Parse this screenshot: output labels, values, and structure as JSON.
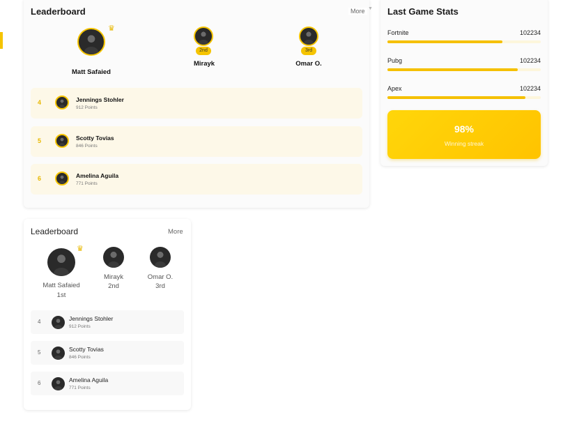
{
  "leaderboard_primary": {
    "title": "Leaderboard",
    "more_label": "More",
    "podium": [
      {
        "name": "Matt Safaied",
        "badge": "",
        "icon": "crown-icon"
      },
      {
        "name": "Mirayk",
        "badge": "2nd"
      },
      {
        "name": "Omar O.",
        "badge": "3rd"
      }
    ],
    "rows": [
      {
        "rank": "4",
        "name": "Jennings Stohler",
        "points": "912 Points"
      },
      {
        "rank": "5",
        "name": "Scotty Tovias",
        "points": "846 Points"
      },
      {
        "rank": "6",
        "name": "Amelina Aguila",
        "points": "771 Points"
      }
    ]
  },
  "last_game_stats": {
    "title": "Last Game Stats",
    "games": [
      {
        "name": "Fortnite",
        "value": "102234",
        "progress": 0.75
      },
      {
        "name": "Pubg",
        "value": "102234",
        "progress": 0.85
      },
      {
        "name": "Apex",
        "value": "102234",
        "progress": 0.9
      }
    ],
    "streak": {
      "percent": "98%",
      "label": "Winning streak"
    }
  },
  "leaderboard_secondary": {
    "title": "Leaderboard",
    "more_label": "More",
    "podium": [
      {
        "name": "Matt Safaied",
        "place": "1st",
        "icon": "crown-icon"
      },
      {
        "name": "Mirayk",
        "place": "2nd"
      },
      {
        "name": "Omar O.",
        "place": "3rd"
      }
    ],
    "rows": [
      {
        "rank": "4",
        "name": "Jennings Stohler",
        "points": "912 Points"
      },
      {
        "rank": "5",
        "name": "Scotty Tovias",
        "points": "846 Points"
      },
      {
        "rank": "6",
        "name": "Amelina Aguila",
        "points": "771 Points"
      }
    ]
  },
  "colors": {
    "accent": "#f5c400",
    "row_tint": "#fdf8e8"
  }
}
